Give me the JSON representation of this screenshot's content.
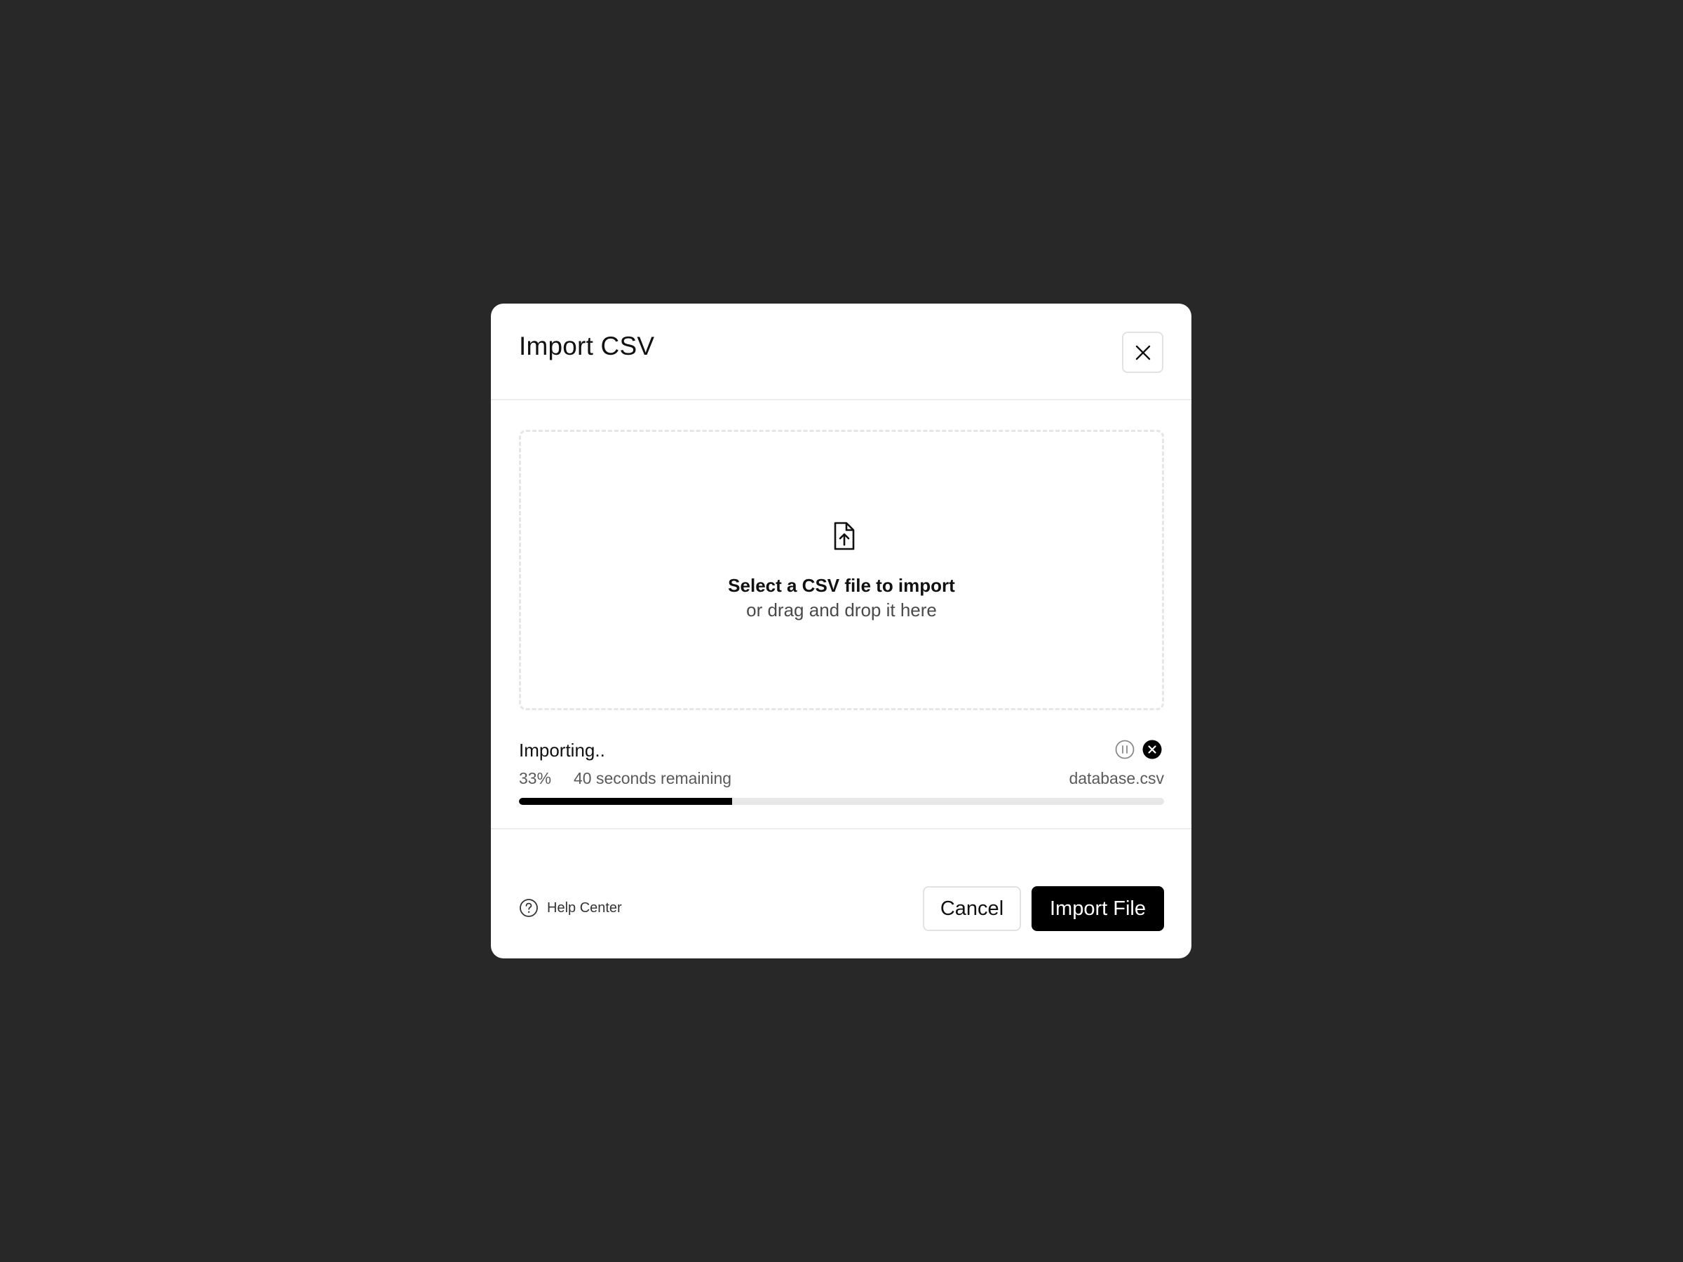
{
  "colors": {
    "backdrop": "#282828",
    "modal_bg": "#ffffff",
    "primary_button": "#000000",
    "progress_fill": "#000000",
    "progress_track": "#e7e7e7"
  },
  "modal": {
    "title": "Import CSV",
    "close_icon": "close-icon"
  },
  "dropzone": {
    "icon": "file-upload-icon",
    "title": "Select a CSV file to import",
    "subtitle": "or drag and drop it here"
  },
  "progress": {
    "status": "Importing..",
    "percent_label": "33%",
    "percent_value": 0.33,
    "time_remaining": "40 seconds remaining",
    "file_name": "database.csv",
    "pause_icon": "pause-icon",
    "cancel_icon": "cancel-circle-icon"
  },
  "footer": {
    "help_icon": "help-circle-icon",
    "help_label": "Help Center",
    "cancel_label": "Cancel",
    "import_label": "Import File"
  }
}
